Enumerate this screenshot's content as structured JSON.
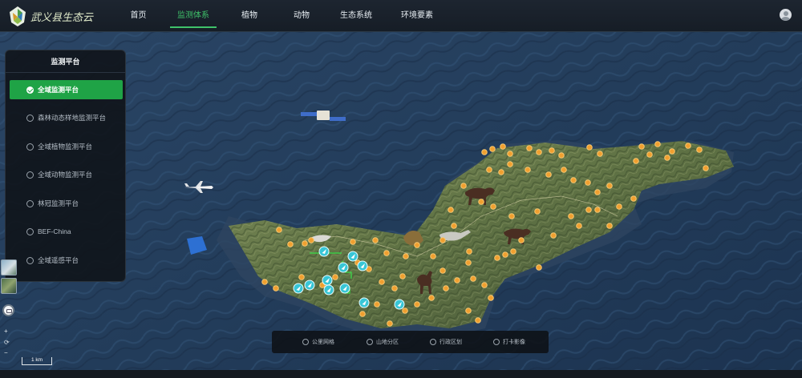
{
  "app": {
    "logo_text": "武义县生态云"
  },
  "nav": {
    "items": [
      {
        "label": "首页",
        "active": false
      },
      {
        "label": "监测体系",
        "active": true
      },
      {
        "label": "植物",
        "active": false
      },
      {
        "label": "动物",
        "active": false
      },
      {
        "label": "生态系统",
        "active": false
      },
      {
        "label": "环境要素",
        "active": false
      }
    ],
    "user_icon": "user-avatar-icon"
  },
  "panel": {
    "title": "监测平台",
    "items": [
      {
        "label": "全域监测平台",
        "selected": true
      },
      {
        "label": "森林动态样地监测平台",
        "selected": false
      },
      {
        "label": "全域植物监测平台",
        "selected": false
      },
      {
        "label": "全域动物监测平台",
        "selected": false
      },
      {
        "label": "林冠监测平台",
        "selected": false
      },
      {
        "label": "BEF-China",
        "selected": false
      },
      {
        "label": "全域遥感平台",
        "selected": false
      }
    ]
  },
  "map_controls": {
    "zoom_in": "+",
    "reset": "⟳",
    "zoom_out": "−",
    "scale_label": "1 km"
  },
  "layers": {
    "items": [
      {
        "label": "公里网格",
        "selected": false
      },
      {
        "label": "山地分区",
        "selected": false
      },
      {
        "label": "行政区划",
        "selected": false
      },
      {
        "label": "打卡影像",
        "selected": false
      }
    ]
  },
  "colors": {
    "accent_green": "#1fa346",
    "nav_active": "#3fc26a",
    "marker_orange": "#f0a030",
    "marker_cyan": "#38c6d6"
  }
}
